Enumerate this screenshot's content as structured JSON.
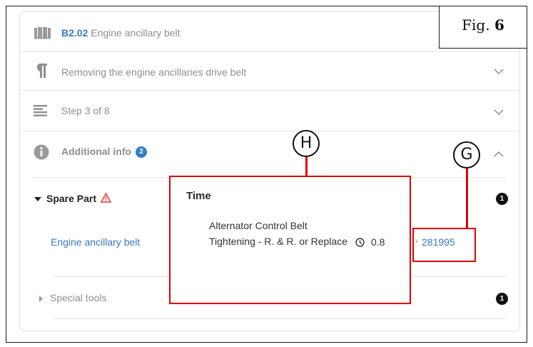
{
  "figure": {
    "label": "Fig.",
    "number": "6"
  },
  "header": {
    "code": "B2.02",
    "title": "Engine ancillary belt",
    "icon": "book-icon"
  },
  "rows": [
    {
      "icon": "paragraph-icon",
      "label": "Removing the engine ancillaries drive belt",
      "chevron": "chevron-down-icon"
    },
    {
      "icon": "list-icon",
      "label": "Step 3 of 8",
      "chevron": "chevron-down-icon"
    }
  ],
  "additional_info": {
    "icon": "info-icon",
    "label": "Additional info",
    "count": "2",
    "chevron": "chevron-up-icon"
  },
  "spare_part": {
    "label": "Spare Part",
    "warning_icon": "warning-triangle-icon",
    "count": "1",
    "item_name": "Engine ancillary belt",
    "item_reference": "281995",
    "arrow_glyph": "›"
  },
  "special_tools": {
    "label": "Special tools",
    "count": "1"
  },
  "time_popup": {
    "title": "Time",
    "operation": "Alternator Control Belt Tightening - R. & R. or Replace",
    "time_icon": "clock-icon",
    "time_value": "0.8"
  },
  "callouts": {
    "h": "H",
    "g": "G"
  },
  "colors": {
    "link": "#3a78c3",
    "callout": "#e00000",
    "badge": "#2f7fc4",
    "warning": "#e53935"
  }
}
